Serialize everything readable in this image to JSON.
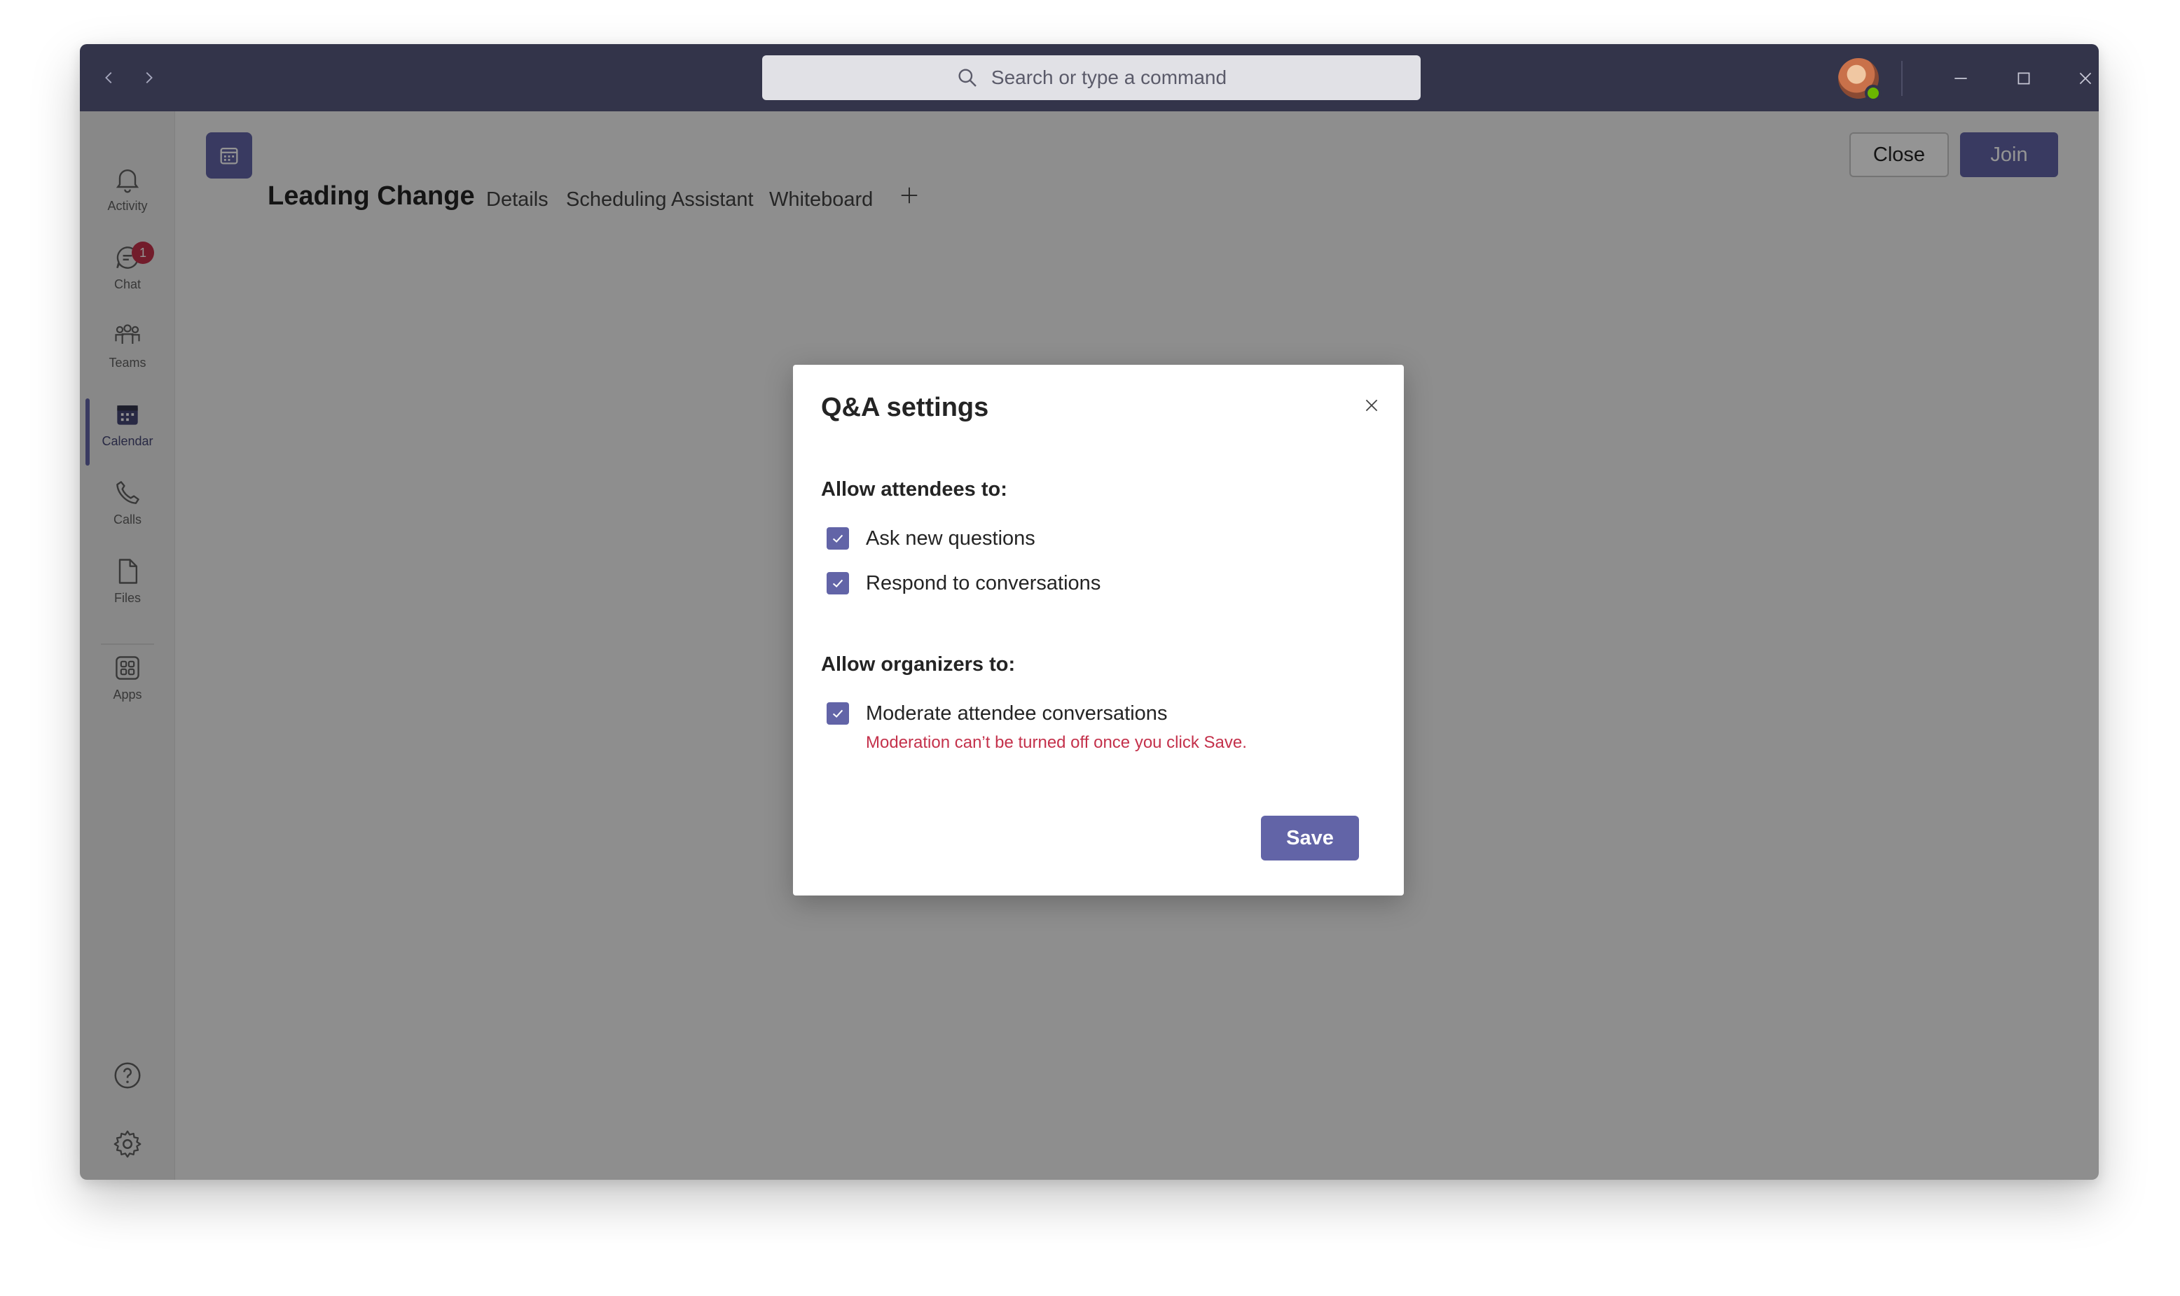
{
  "titlebar": {
    "search_placeholder": "Search or type a command",
    "back_icon": "chevron-left-icon",
    "forward_icon": "chevron-right-icon"
  },
  "rail": {
    "items": [
      {
        "label": "Activity",
        "icon": "bell-icon"
      },
      {
        "label": "Chat",
        "icon": "chat-icon",
        "badge": "1"
      },
      {
        "label": "Teams",
        "icon": "teams-icon"
      },
      {
        "label": "Calendar",
        "icon": "calendar-icon",
        "active": true
      },
      {
        "label": "Calls",
        "icon": "phone-icon"
      },
      {
        "label": "Files",
        "icon": "file-icon"
      },
      {
        "label": "Apps",
        "icon": "apps-icon"
      }
    ],
    "bottom": [
      {
        "icon": "help-icon"
      },
      {
        "icon": "gear-icon"
      }
    ]
  },
  "header": {
    "title": "Leading Change",
    "tabs": [
      "Details",
      "Scheduling Assistant",
      "Whiteboard"
    ],
    "close_label": "Close",
    "join_label": "Join"
  },
  "dialog": {
    "title": "Q&A settings",
    "attendees_label": "Allow attendees to:",
    "attendee_options": [
      {
        "label": "Ask new questions",
        "checked": true
      },
      {
        "label": "Respond to conversations",
        "checked": true
      }
    ],
    "organizers_label": "Allow organizers to:",
    "organizer_options": [
      {
        "label": "Moderate attendee conversations",
        "checked": true
      }
    ],
    "warning": "Moderation can’t be turned off once you click Save.",
    "save_label": "Save"
  },
  "colors": {
    "brand": "#6264a7",
    "titlebar": "#33344a",
    "warning": "#c4314b",
    "presence": "#6bb700"
  }
}
